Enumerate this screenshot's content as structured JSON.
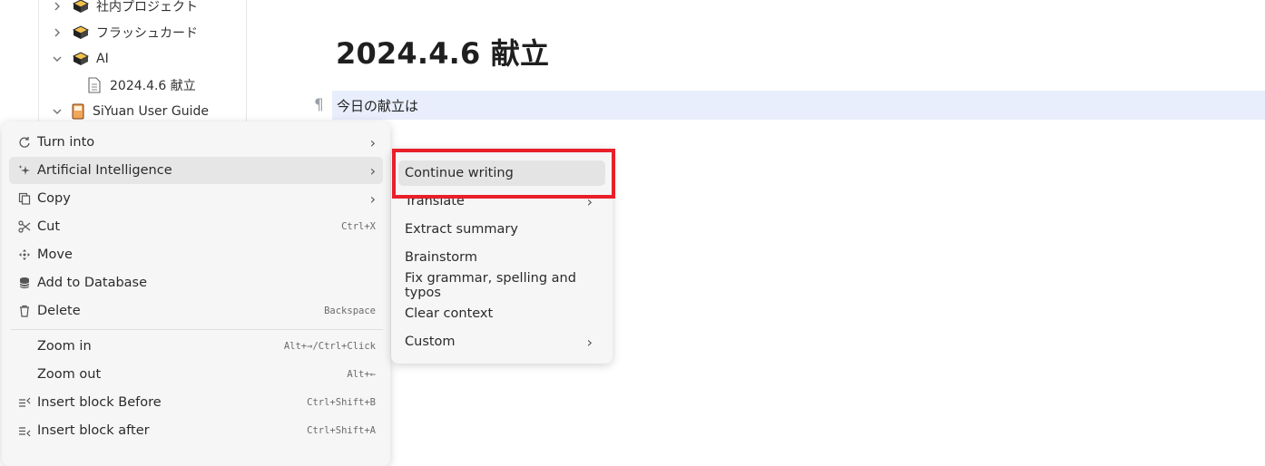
{
  "sidebar": {
    "items": [
      {
        "label": "社内プロジェクト",
        "expanded": false
      },
      {
        "label": "フラッシュカード",
        "expanded": false
      },
      {
        "label": "AI",
        "expanded": true
      },
      {
        "label": "2024.4.6 献立"
      },
      {
        "label": "SiYuan User Guide",
        "expanded": true
      }
    ]
  },
  "editor": {
    "title": "2024.4.6 献立",
    "paragraph_mark": "¶",
    "block_text": "今日の献立は"
  },
  "context_menu": {
    "items": [
      {
        "label": "Turn into",
        "icon": "refresh-icon",
        "submenu": true
      },
      {
        "label": "Artificial Intelligence",
        "icon": "sparkle-icon",
        "submenu": true,
        "active": true
      },
      {
        "label": "Copy",
        "icon": "copy-icon",
        "submenu": true
      },
      {
        "label": "Cut",
        "icon": "scissors-icon",
        "shortcut": "Ctrl+X"
      },
      {
        "label": "Move",
        "icon": "move-icon"
      },
      {
        "label": "Add to Database",
        "icon": "database-icon"
      },
      {
        "label": "Delete",
        "icon": "trash-icon",
        "shortcut": "Backspace"
      },
      {
        "label": "Zoom in",
        "shortcut": "Alt+→/Ctrl+Click"
      },
      {
        "label": "Zoom out",
        "shortcut": "Alt+←"
      },
      {
        "label": "Insert block Before",
        "icon": "insert-before-icon",
        "shortcut": "Ctrl+Shift+B"
      },
      {
        "label": "Insert block after",
        "icon": "insert-after-icon",
        "shortcut": "Ctrl+Shift+A"
      }
    ]
  },
  "ai_submenu": {
    "items": [
      {
        "label": "Continue writing",
        "active": true
      },
      {
        "label": "Translate",
        "submenu": true
      },
      {
        "label": "Extract summary"
      },
      {
        "label": "Brainstorm"
      },
      {
        "label": "Fix grammar, spelling and typos"
      },
      {
        "label": "Clear context"
      },
      {
        "label": "Custom",
        "submenu": true
      }
    ]
  },
  "colors": {
    "highlight_border": "#e8202a",
    "block_highlight": "#e8eefb",
    "menu_bg": "#f6f6f6"
  }
}
